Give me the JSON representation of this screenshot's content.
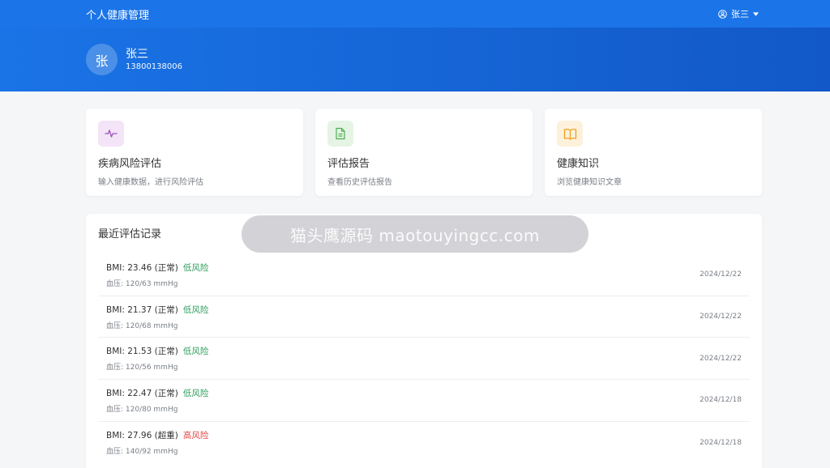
{
  "header": {
    "app_title": "个人健康管理",
    "user_name": "张三",
    "user_icon": "user-circle-icon",
    "dropdown_icon": "caret-down-icon"
  },
  "profile": {
    "avatar_text": "张",
    "name": "张三",
    "phone": "13800138006"
  },
  "cards": [
    {
      "title": "疾病风险评估",
      "desc": "输入健康数据，进行风险评估",
      "icon": "pulse-icon",
      "icon_color": "#9b4fc0",
      "icon_bg": "#f3e4f7"
    },
    {
      "title": "评估报告",
      "desc": "查看历史评估报告",
      "icon": "document-icon",
      "icon_color": "#4caf50",
      "icon_bg": "#e6f4e6"
    },
    {
      "title": "健康知识",
      "desc": "浏览健康知识文章",
      "icon": "book-icon",
      "icon_color": "#f0a020",
      "icon_bg": "#fdf1dc"
    }
  ],
  "records": {
    "title": "最近评估记录",
    "items": [
      {
        "bmi": "BMI: 23.46 (正常)",
        "risk": "低风险",
        "risk_color": "#2e9e5e",
        "bp": "血压: 120/63 mmHg",
        "date": "2024/12/22"
      },
      {
        "bmi": "BMI: 21.37 (正常)",
        "risk": "低风险",
        "risk_color": "#2e9e5e",
        "bp": "血压: 120/68 mmHg",
        "date": "2024/12/22"
      },
      {
        "bmi": "BMI: 21.53 (正常)",
        "risk": "低风险",
        "risk_color": "#2e9e5e",
        "bp": "血压: 120/56 mmHg",
        "date": "2024/12/22"
      },
      {
        "bmi": "BMI: 22.47 (正常)",
        "risk": "低风险",
        "risk_color": "#2e9e5e",
        "bp": "血压: 120/80 mmHg",
        "date": "2024/12/18"
      },
      {
        "bmi": "BMI: 27.96 (超重)",
        "risk": "高风险",
        "risk_color": "#e04848",
        "bp": "血压: 140/92 mmHg",
        "date": "2024/12/18"
      }
    ]
  },
  "watermark": {
    "text": "猫头鹰源码 maotouyingcc.com"
  },
  "colors": {
    "primary": "#1b75e8",
    "low_risk": "#2e9e5e",
    "high_risk": "#e04848"
  }
}
